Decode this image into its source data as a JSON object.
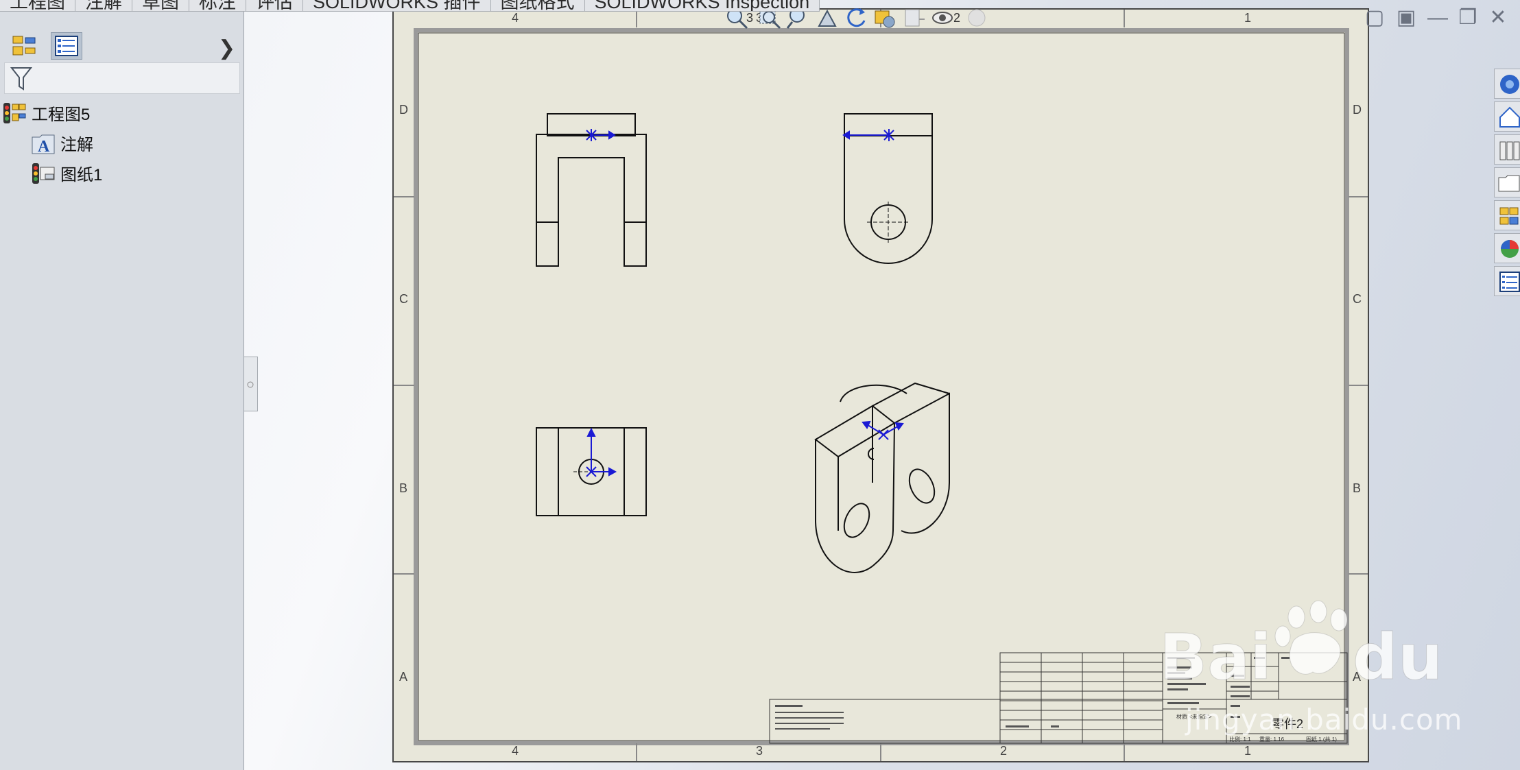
{
  "tabs": [
    "工程图",
    "注解",
    "草图",
    "标注",
    "评估",
    "SOLIDWORKS 插件",
    "图纸格式",
    "SOLIDWORKS Inspection"
  ],
  "feature_tree": {
    "root": "工程图5",
    "children": [
      "注解",
      "图纸1"
    ]
  },
  "hud": {
    "zoom_badge": "3",
    "hide_show_badge": "2"
  },
  "sheet": {
    "zones_x": [
      "4",
      "3",
      "2",
      "1"
    ],
    "zones_y": [
      "D",
      "C",
      "B",
      "A"
    ],
    "title_block": {
      "part_name": "零件2",
      "scale": "比例: 1:1",
      "sheet_no": "图纸 1 (共 1)",
      "weight": "重量: 1.16",
      "material": "材质 <未指定>"
    }
  },
  "watermark": {
    "text": "jingyan.baidu.com",
    "brand": "Baidu 经验"
  },
  "icons": {
    "feature_manager": "feature-manager-icon",
    "property_manager": "property-manager-icon",
    "filter": "filter-icon",
    "annotation": "annotation-folder-icon",
    "sheet": "sheet-icon"
  },
  "colors": {
    "sheet_bg": "#e8e7da",
    "line": "#111111",
    "axis_blue": "#1a1ad4"
  }
}
